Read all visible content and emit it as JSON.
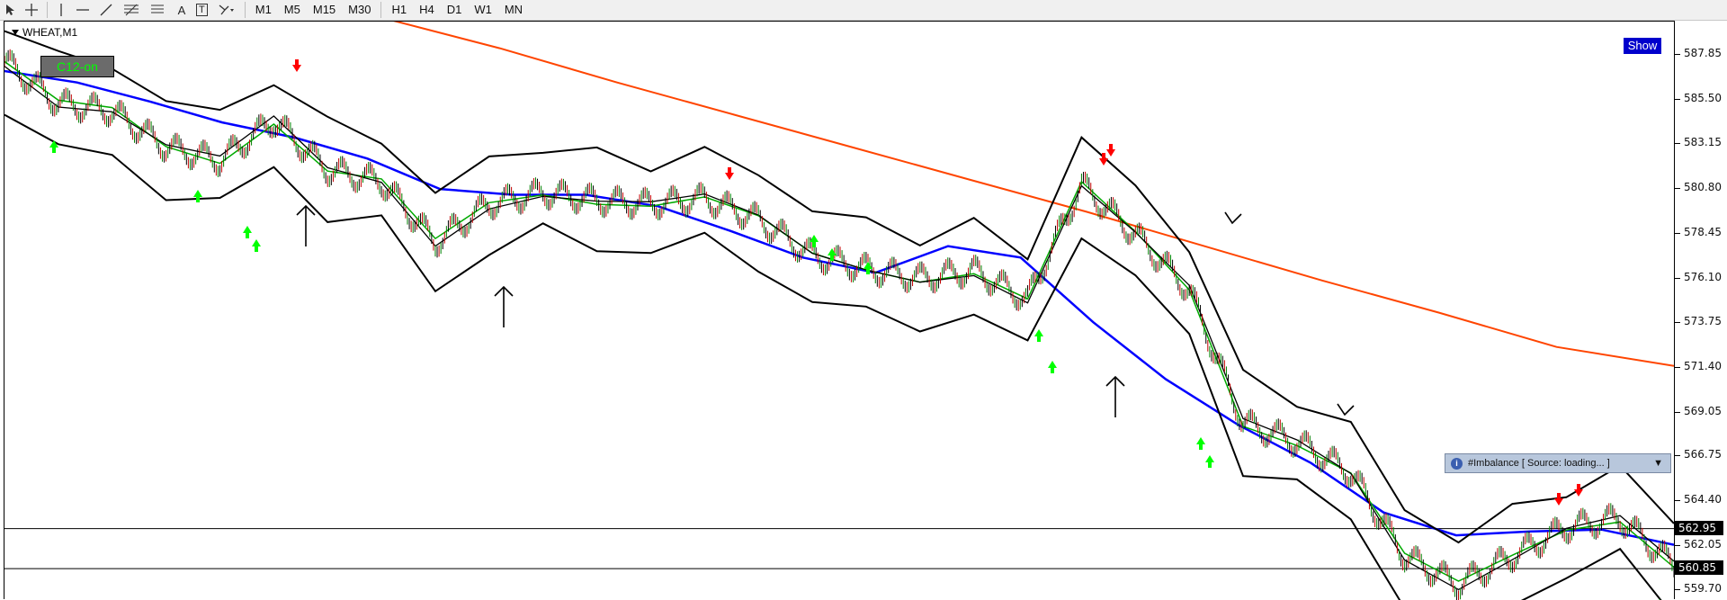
{
  "toolbar": {
    "tools": [
      "cursor-icon",
      "crosshair-icon",
      "vertical-line-icon",
      "horizontal-line-icon",
      "trendline-icon",
      "fibonacci-icon",
      "fibonacci-fan-icon",
      "text-icon",
      "text-label-icon",
      "shapes-icon"
    ],
    "text_tool_label": "A",
    "text_label_tool_label": "T",
    "timeframes": [
      "M1",
      "M5",
      "M15",
      "M30",
      "H1",
      "H4",
      "D1",
      "W1",
      "MN"
    ]
  },
  "chart": {
    "symbol_label": "WHEAT,M1",
    "c12_label": "C12-on",
    "show_button": "Show",
    "imbalance_label": "#Imbalance [ Source: loading... ]"
  },
  "chart_data": {
    "type": "line",
    "title": "",
    "axis_ticks": [
      "587.85",
      "585.50",
      "583.15",
      "580.80",
      "578.45",
      "576.10",
      "573.75",
      "571.40",
      "569.05",
      "566.75",
      "564.40",
      "562.05",
      "559.70"
    ],
    "price_levels": [
      {
        "value": 562.95,
        "label": "562.95"
      },
      {
        "value": 560.85,
        "label": "560.85"
      }
    ],
    "ylim": [
      559.2,
      589.6
    ],
    "colors": {
      "ma_long": "#ff4500",
      "ma_mid": "#0000ff",
      "ma_fast": "#00aa00",
      "bands": "#000000",
      "arrow_up": "#00ff00",
      "arrow_down": "#ff0000"
    },
    "series": [
      {
        "values": [
          589.8,
          588.2,
          586.4,
          584.7,
          583.0,
          581.3,
          579.6,
          577.8,
          576.0,
          574.3,
          572.5,
          571.5
        ]
      },
      {
        "values": [
          587.0,
          586.4,
          585.4,
          584.3,
          583.5,
          582.4,
          580.8,
          580.5,
          580.5,
          579.9,
          578.6,
          577.2,
          576.4,
          577.8,
          577.2,
          573.8,
          570.8,
          568.4,
          566.4,
          563.8,
          562.6,
          562.8,
          562.9,
          562.1
        ]
      },
      {
        "values": [
          587.5,
          585.3,
          584.9,
          583.0,
          582.3,
          584.4,
          581.8,
          581.2,
          578.0,
          580.0,
          580.6,
          580.2,
          580.0,
          580.3,
          579.2,
          577.3,
          576.6,
          576.1,
          576.5,
          575.0,
          581.0,
          578.4,
          575.5,
          568.5,
          567.5,
          565.9,
          561.5,
          560.0,
          561.5,
          563.0,
          563.5,
          561.0
        ]
      }
    ]
  }
}
